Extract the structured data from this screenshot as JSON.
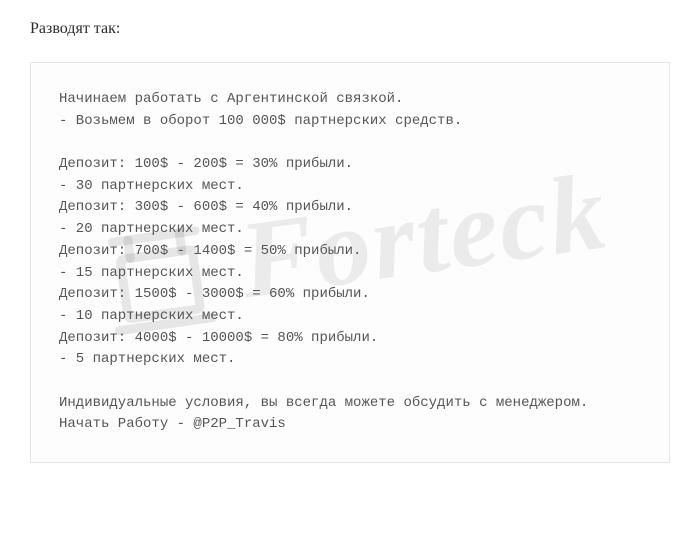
{
  "heading": "Разводят так:",
  "watermark_text": "Forteck",
  "message": {
    "intro": [
      "Начинаем работать с Аргентинской связкой.",
      "- Возьмем в оборот 100 000$ партнерских средств."
    ],
    "tiers": [
      "Депозит: 100$ - 200$ = 30% прибыли.",
      "- 30 партнерских мест.",
      "Депозит: 300$ - 600$ = 40% прибыли.",
      "- 20 партнерских мест.",
      "Депозит: 700$ - 1400$ = 50% прибыли.",
      "- 15 партнерских мест.",
      "Депозит: 1500$ - 3000$ = 60% прибыли.",
      "- 10 партнерских мест.",
      "Депозит: 4000$ - 10000$ = 80% прибыли.",
      "- 5 партнерских мест."
    ],
    "outro": [
      "Индивидуальные условия, вы всегда можете обсудить с менеджером.",
      "Начать Работу - @P2P_Travis"
    ]
  }
}
